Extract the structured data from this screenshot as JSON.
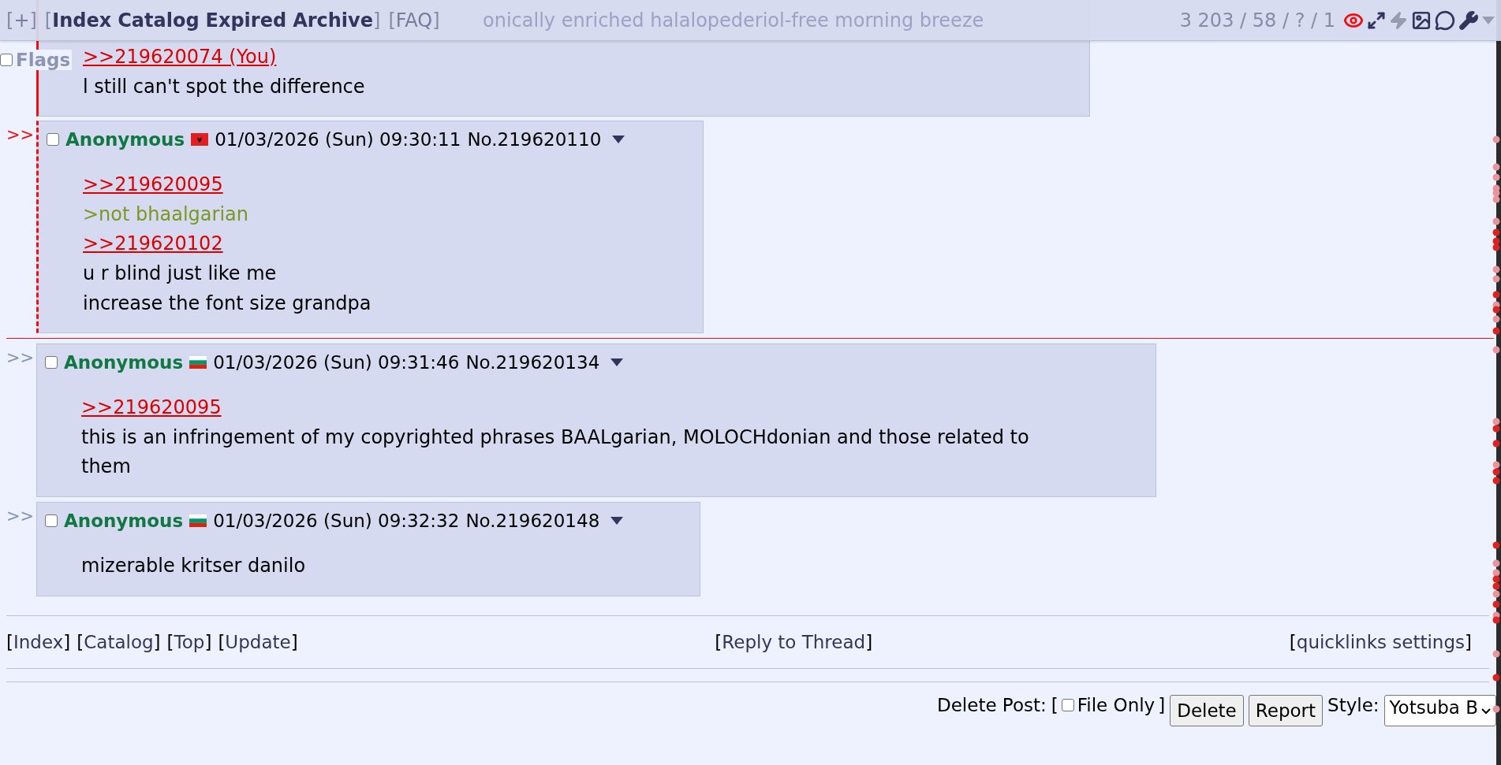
{
  "brackets": {
    "open": "[",
    "close": "]"
  },
  "header": {
    "toggle": "+",
    "board_links": [
      "Index",
      "Catalog",
      "Expired",
      "Archive"
    ],
    "faq": "FAQ",
    "subject_behind": "onically enriched halalopederiol-free morning breeze",
    "stats": "3 203 / 58 / ? / 1"
  },
  "flags_option": {
    "label": "Flags",
    "checked": false
  },
  "posts": [
    {
      "quotes_you": true,
      "highlighted": false,
      "cut_top": true,
      "lines": [
        {
          "kind": "quotelink",
          "text": ">>219620074 (You)"
        },
        {
          "kind": "text",
          "text": "l still can't spot the difference"
        }
      ]
    },
    {
      "backlink": ">>",
      "backlink_active": true,
      "quotes_you": false,
      "highlighted": true,
      "cut_top": false,
      "checked": false,
      "name": "Anonymous",
      "flag": {
        "kind": "albania"
      },
      "date": "01/03/2026 (Sun) 09:30:11",
      "number": "No.219620110",
      "lines": [
        {
          "kind": "quotelink",
          "text": ">>219620095"
        },
        {
          "kind": "greentext",
          "text": ">not bhaalgarian"
        },
        {
          "kind": "quotelink",
          "text": ">>219620102"
        },
        {
          "kind": "text",
          "text": "u r blind just like me"
        },
        {
          "kind": "text",
          "text": "increase the font size grandpa"
        }
      ],
      "unread_line_after": true
    },
    {
      "backlink": ">>",
      "backlink_active": false,
      "quotes_you": false,
      "highlighted": false,
      "cut_top": false,
      "checked": false,
      "name": "Anonymous",
      "flag": {
        "kind": "bulgaria"
      },
      "date": "01/03/2026 (Sun) 09:31:46",
      "number": "No.219620134",
      "lines": [
        {
          "kind": "quotelink",
          "text": ">>219620095"
        },
        {
          "kind": "text",
          "text": "this is an infringement of my copyrighted phrases BAALgarian, MOLOCHdonian and those related to them"
        }
      ]
    },
    {
      "backlink": ">>",
      "backlink_active": false,
      "quotes_you": false,
      "highlighted": false,
      "cut_top": false,
      "checked": false,
      "name": "Anonymous",
      "flag": {
        "kind": "bulgaria"
      },
      "date": "01/03/2026 (Sun) 09:32:32",
      "number": "No.219620148",
      "lines": [
        {
          "kind": "text",
          "text": "mizerable kritser danilo"
        }
      ]
    }
  ],
  "nav": {
    "left": [
      "Index",
      "Catalog",
      "Top",
      "Update"
    ],
    "center": [
      "Reply to Thread"
    ],
    "right": [
      "quicklinks settings"
    ]
  },
  "delete_bar": {
    "label": "Delete Post:",
    "file_only": {
      "label": "File Only",
      "checked": false
    },
    "buttons": [
      "Delete",
      "Report"
    ],
    "style_label": "Style:",
    "style_value": "Yotsuba B"
  }
}
